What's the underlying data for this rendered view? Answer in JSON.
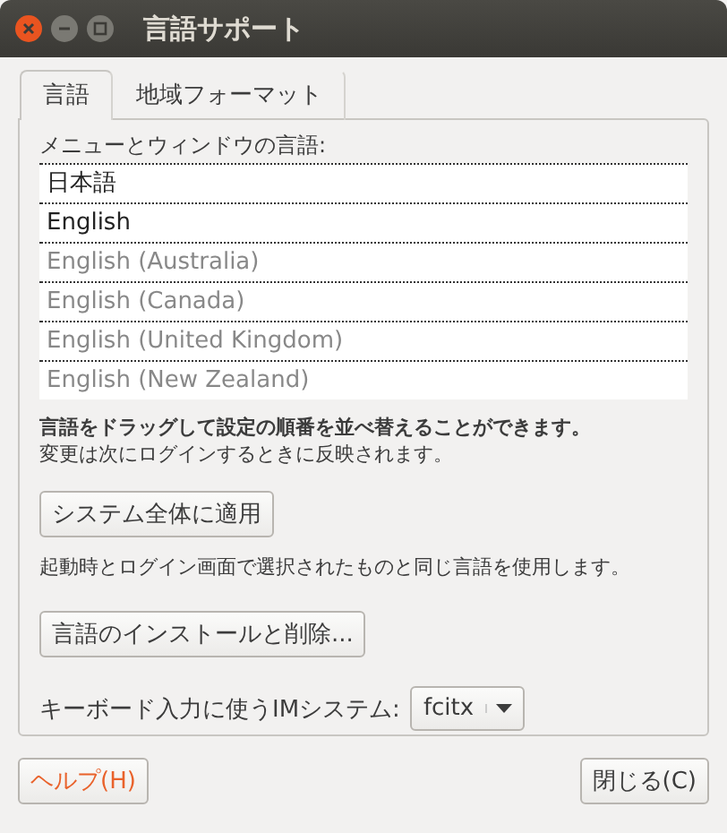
{
  "window": {
    "title": "言語サポート"
  },
  "tabs": [
    {
      "label": "言語",
      "selected": true
    },
    {
      "label": "地域フォーマット",
      "selected": false
    }
  ],
  "language_list": {
    "label": "メニューとウィンドウの言語:",
    "items": [
      {
        "label": "日本語",
        "disabled": false
      },
      {
        "label": "English",
        "disabled": false
      },
      {
        "label": "English (Australia)",
        "disabled": true
      },
      {
        "label": "English (Canada)",
        "disabled": true
      },
      {
        "label": "English (United Kingdom)",
        "disabled": true
      },
      {
        "label": "English (New Zealand)",
        "disabled": true
      }
    ]
  },
  "hint_bold": "言語をドラッグして設定の順番を並べ替えることができます。",
  "hint": "変更は次にログインするときに反映されます。",
  "apply_button": "システム全体に適用",
  "apply_note": "起動時とログイン画面で選択されたものと同じ言語を使用します。",
  "install_button": "言語のインストールと削除...",
  "im_system": {
    "label": "キーボード入力に使うIMシステム:",
    "value": "fcitx"
  },
  "footer": {
    "help": "ヘルプ(H)",
    "close": "閉じる(C)"
  }
}
